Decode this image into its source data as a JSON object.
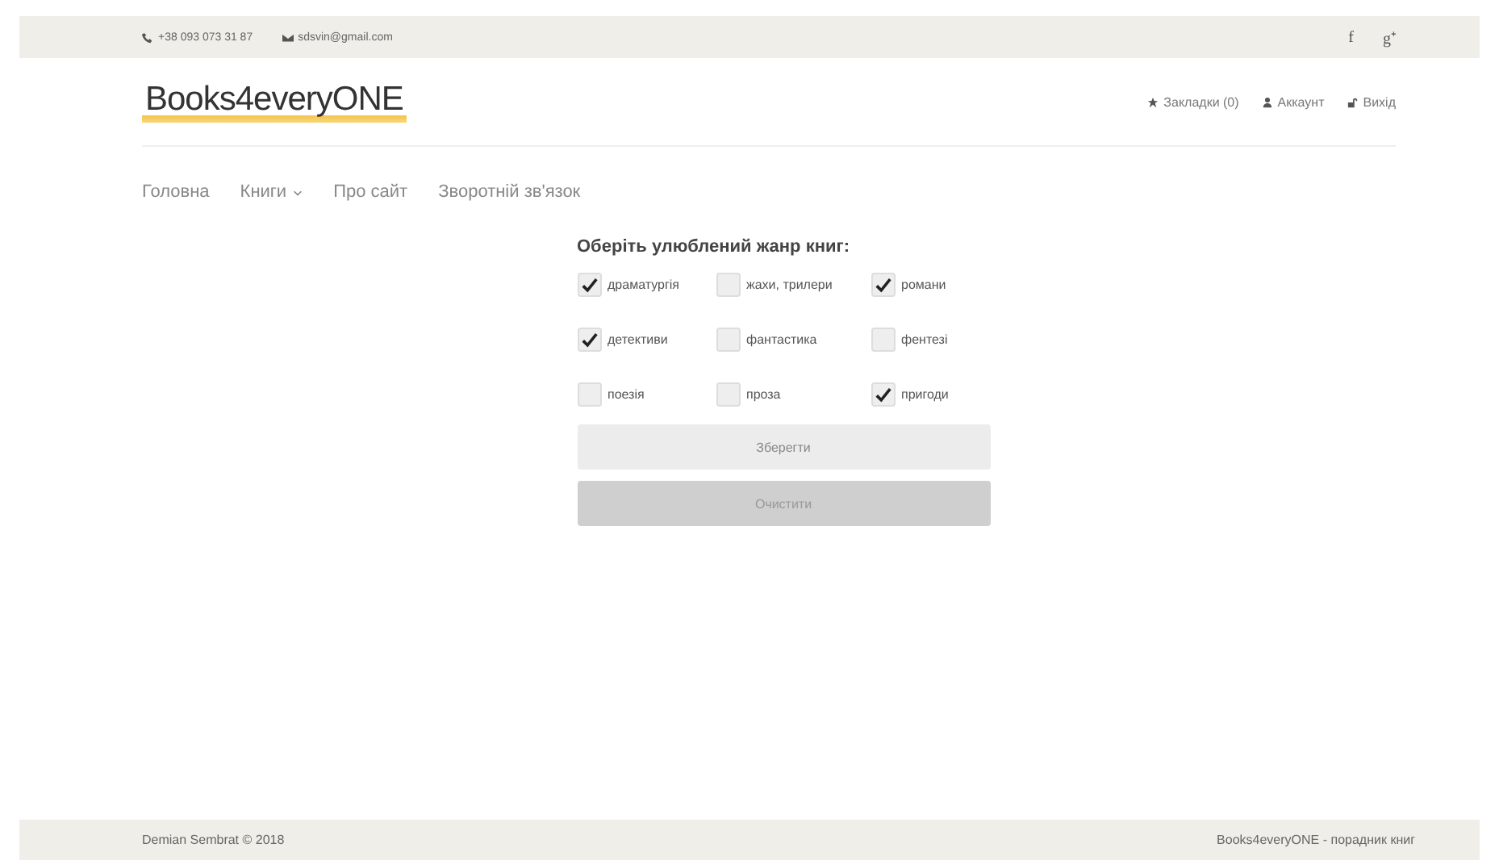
{
  "topbar": {
    "phone": "+38 093 073 31 87",
    "email": "sdsvin@gmail.com",
    "social": [
      "f",
      "g⁺"
    ]
  },
  "logo": "Books4everyONE",
  "user_links": [
    {
      "label": "Закладки (0)"
    },
    {
      "label": "Аккаунт"
    },
    {
      "label": "Вихід"
    }
  ],
  "nav": [
    {
      "label": "Головна",
      "dropdown": false
    },
    {
      "label": "Книги",
      "dropdown": true
    },
    {
      "label": "Про сайт",
      "dropdown": false
    },
    {
      "label": "Зворотній зв'язок",
      "dropdown": false
    }
  ],
  "form": {
    "title": "Оберіть улюблений жанр книг:",
    "genres": [
      {
        "label": "драматургія",
        "checked": true
      },
      {
        "label": "жахи, трилери",
        "checked": false
      },
      {
        "label": "романи",
        "checked": true
      },
      {
        "label": "детективи",
        "checked": true
      },
      {
        "label": "фантастика",
        "checked": false
      },
      {
        "label": "фентезі",
        "checked": false
      },
      {
        "label": "поезія",
        "checked": false
      },
      {
        "label": "проза",
        "checked": false
      },
      {
        "label": "пригоди",
        "checked": true
      }
    ],
    "buttons": [
      {
        "label": "Зберегти",
        "kind": "primary"
      },
      {
        "label": "Очистити",
        "kind": "secondary"
      }
    ]
  },
  "footer": {
    "left": "Demian Sembrat © 2018",
    "right": "Books4everyONE - порадник книг"
  }
}
